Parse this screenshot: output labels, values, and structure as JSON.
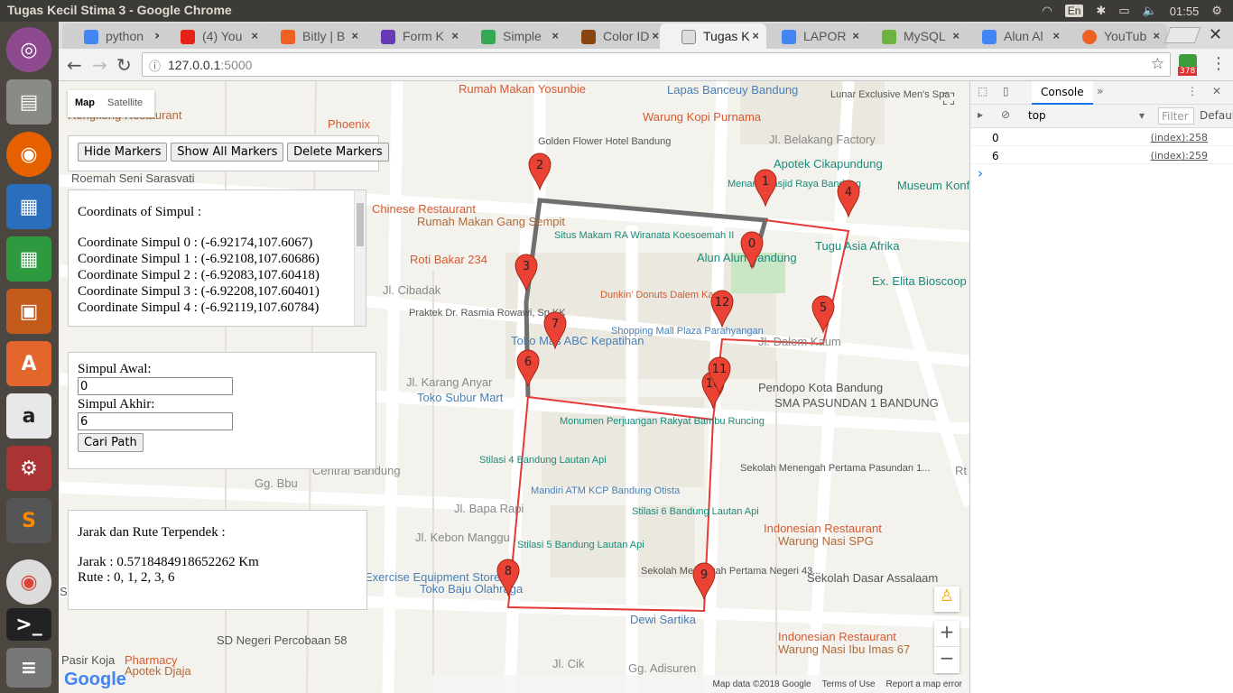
{
  "os": {
    "window_title": "Tugas Kecil Stima 3 - Google Chrome",
    "keyboard": "En",
    "time": "01:55"
  },
  "tabs": [
    {
      "label": "python",
      "color": "#4285f4"
    },
    {
      "label": "(4) You",
      "color": "#e62117"
    },
    {
      "label": "Bitly | B",
      "color": "#ee6123"
    },
    {
      "label": "Form K",
      "color": "#673ab7"
    },
    {
      "label": "Simple",
      "color": "#34a853"
    },
    {
      "label": "Color ID",
      "color": "#8b4513"
    },
    {
      "label": "Tugas K",
      "color": "#888888"
    },
    {
      "label": "LAPOR",
      "color": "#4285f4"
    },
    {
      "label": "MySQL",
      "color": "#6db33f"
    },
    {
      "label": "Alun Al",
      "color": "#4285f4"
    },
    {
      "label": "YouTub",
      "color": "#ee6123"
    }
  ],
  "address": {
    "host": "127.0.0.1",
    "port": ":5000"
  },
  "ext_badge": "378",
  "map": {
    "type_map": "Map",
    "type_satellite": "Satellite",
    "footer_data": "Map data ©2018 Google",
    "footer_terms": "Terms of Use",
    "footer_report": "Report a map error",
    "zoom_in": "+",
    "zoom_out": "−",
    "logo": "Google",
    "places": [
      "Rumah Makan Yosunbie",
      "Lapas Banceuy Bandung",
      "Lunar Exclusive Men's Spa",
      "Warung Kopi Purnama",
      "Golden Flower Hotel Bandung",
      "Jl. Belakang Factory",
      "Apotek Cikapundung",
      "Menara Masjid Raya Bandung",
      "Museum Konferensi",
      "Chinese Restaurant",
      "Rumah Makan Gang Sempit",
      "Situs Makam RA Wiranata Koesoemah II",
      "Tugu Asia Afrika",
      "Alun Alun Bandung",
      "Roti Bakar 234",
      "Dunkin' Donuts Dalem Kaum",
      "Ex. Elita Bioscoop",
      "Jl. Cibadak",
      "Praktek Dr. Rasmia Rowawi, Sp.KK",
      "Shopping Mall Plaza Parahyangan",
      "Jl. Dalem Kaum",
      "Toko Mas ABC Kepatihan",
      "Pendopo Kota Bandung",
      "SMA PASUNDAN 1 BANDUNG",
      "Toko Subur Mart",
      "Jl. Karang Anyar",
      "Monumen Perjuangan Rakyat Bambu Runcing",
      "Stilasi 4 Bandung Lautan Api",
      "Sekolah Menengah Pertama Pasundan 1...",
      "Mandiri ATM KCP Bandung Otista",
      "Stilasi 6 Bandung Lautan Api",
      "Indonesian Restaurant",
      "Warung Nasi SPG",
      "Stilasi 5 Bandung Lautan Api",
      "Sekolah Menengah Pertama Negeri 43...",
      "Sekolah Dasar Assalaam",
      "Exercise Equipment Store",
      "Toko Baju Olahraga",
      "Dewi Sartika",
      "SD Negeri Percobaan 58",
      "Indonesian Restaurant",
      "Warung Nasi Ibu Imas 67",
      "Pharmacy",
      "Apotek Djaja",
      "Pasir Koja",
      "Sliwangi",
      "Phoenix",
      "Hongkong Restaurant",
      "Roemah Seni Sarasvati",
      "Jl. Bapa Rapi",
      "Jl. Kebon Manggu",
      "Gg. Adisuren",
      "Jl. Cik",
      "Gg. Bbu",
      "Rt",
      "Central Bandung"
    ],
    "markers": [
      "0",
      "1",
      "2",
      "3",
      "4",
      "5",
      "6",
      "7",
      "8",
      "9",
      "10",
      "11",
      "12"
    ]
  },
  "controls": {
    "hide": "Hide Markers",
    "show_all": "Show All Markers",
    "delete": "Delete Markers"
  },
  "coords": {
    "title": "Coordinats of Simpul :",
    "lines": [
      "Coordinate Simpul 0 : (-6.92174,107.6067)",
      "Coordinate Simpul 1 : (-6.92108,107.60686)",
      "Coordinate Simpul 2 : (-6.92083,107.60418)",
      "Coordinate Simpul 3 : (-6.92208,107.60401)",
      "Coordinate Simpul 4 : (-6.92119,107.60784)"
    ]
  },
  "form": {
    "awal_label": "Simpul Awal:",
    "awal_value": "0",
    "akhir_label": "Simpul Akhir:",
    "akhir_value": "6",
    "submit": "Cari Path"
  },
  "result": {
    "title": "Jarak dan Rute Terpendek :",
    "jarak": "Jarak : 0.5718484918652262 Km",
    "rute": "Rute : 0, 1, 2, 3, 6"
  },
  "devtools": {
    "tab": "Console",
    "context": "top",
    "filter": "Filter",
    "levels": "Default",
    "logs": [
      {
        "value": "0",
        "source": "(index):258"
      },
      {
        "value": "6",
        "source": "(index):259"
      }
    ],
    "prompt": "›"
  },
  "colors": {
    "route_gray": "#6f6f6f",
    "route_red": "#e53935",
    "pin": "#ea4335"
  }
}
